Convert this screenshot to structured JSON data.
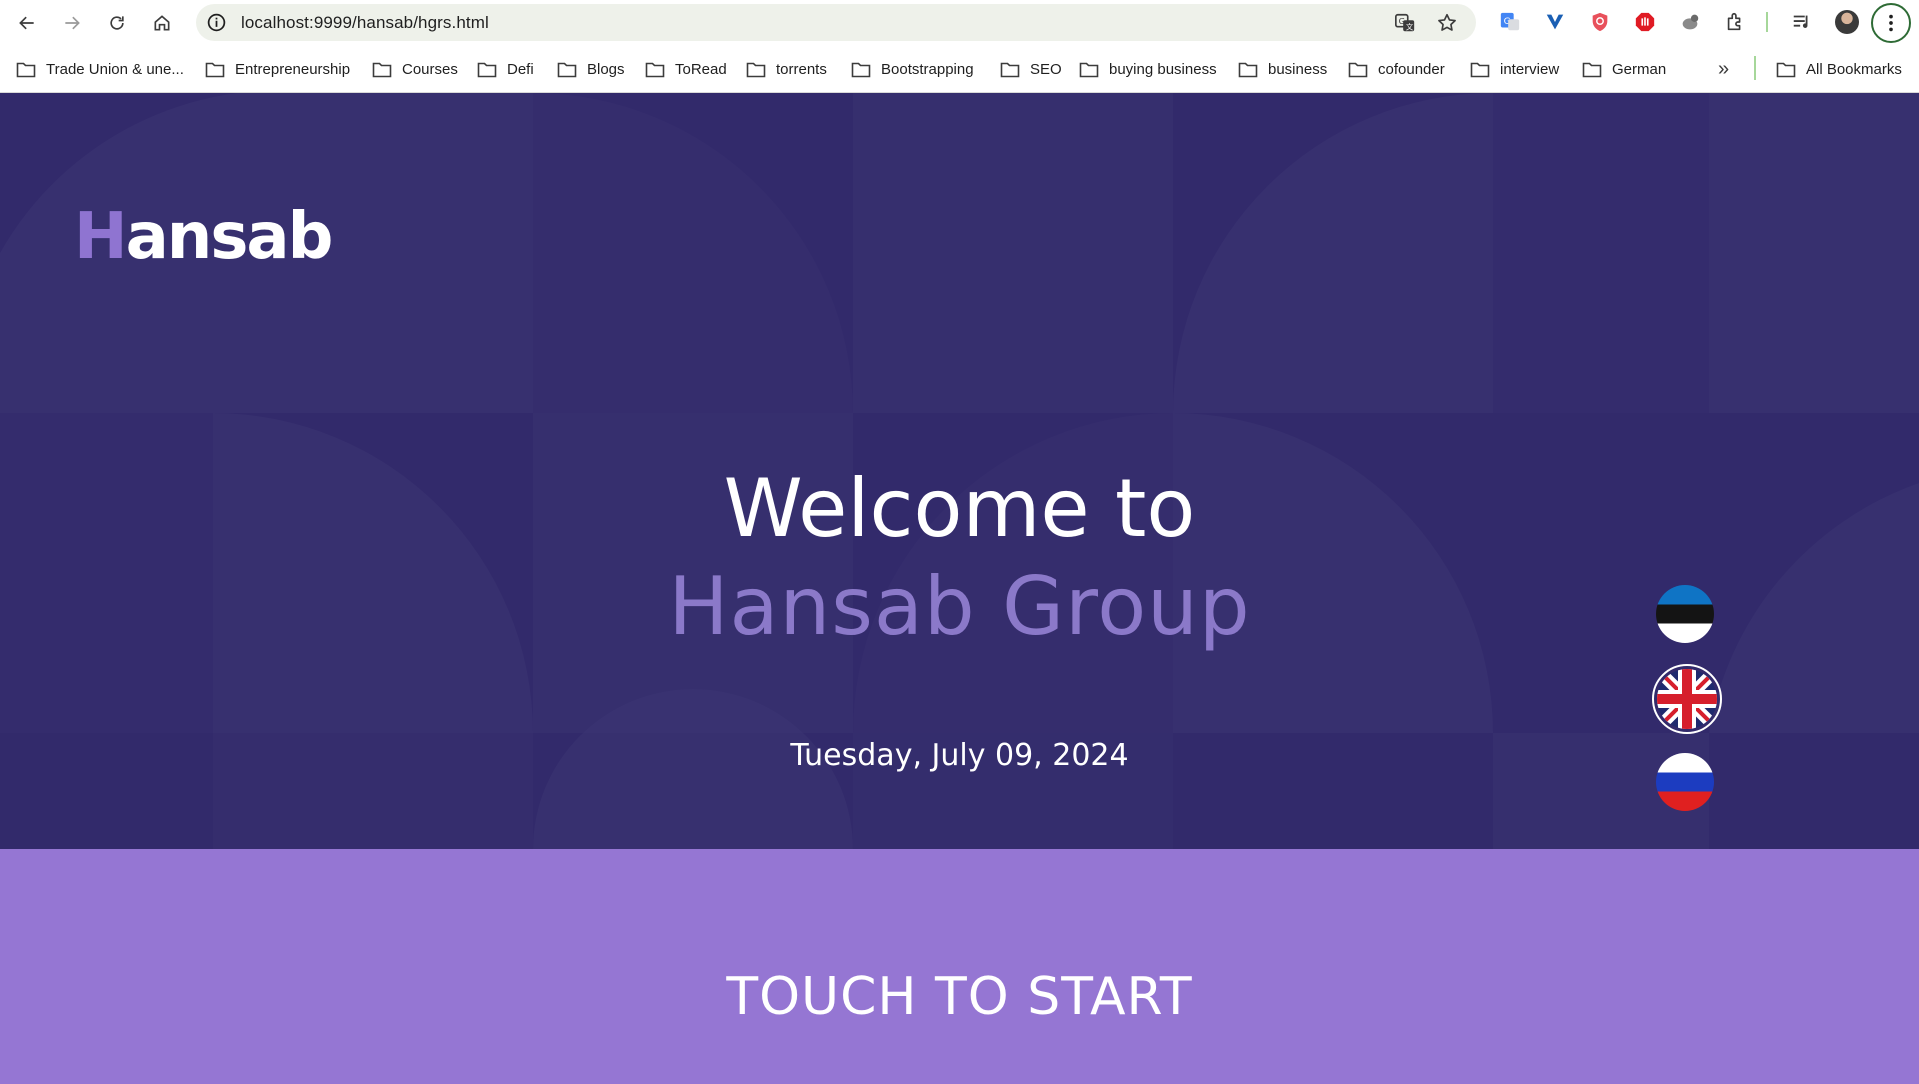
{
  "browser": {
    "url": "localhost:9999/hansab/hgrs.html",
    "icons": [
      "back-icon",
      "forward-icon",
      "reload-icon",
      "home-icon",
      "site-info-icon",
      "translate-icon",
      "bookmark-star-icon",
      "extensions-icon",
      "media-control-icon",
      "menu-icon"
    ],
    "bookmarks": [
      "Trade Union & une...",
      "Entrepreneurship",
      "Courses",
      "Defi",
      "Blogs",
      "ToRead",
      "torrents",
      "Bootstrapping",
      "SEO",
      "buying business",
      "business",
      "cofounder",
      "interview",
      "German"
    ],
    "all_bookmarks": "All Bookmarks",
    "overflow": "»"
  },
  "page": {
    "logo_first": "H",
    "logo_rest": "ansab",
    "welcome_line1": "Welcome to",
    "welcome_line2": "Hansab Group",
    "date": "Tuesday, July 09, 2024",
    "start": "TOUCH TO START",
    "languages": [
      "Estonian",
      "English",
      "Russian"
    ],
    "colors": {
      "hero_bg": "#322a6b",
      "accent": "#8b79c9",
      "start_bg": "#9576d3"
    }
  }
}
